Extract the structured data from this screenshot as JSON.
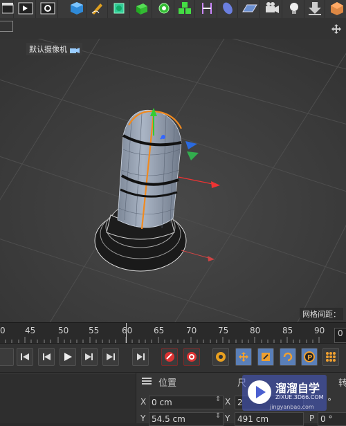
{
  "toolbar": {
    "icons": [
      "clapper-icon",
      "render-view-icon",
      "render-settings-icon",
      "cube-icon",
      "pen-icon",
      "subdivision-icon",
      "extrude-icon",
      "cloner-icon",
      "mograph-icon",
      "deformer-icon",
      "field-icon",
      "floor-icon",
      "camera-icon",
      "light-icon",
      "arrow-down-icon",
      "tag-icon"
    ]
  },
  "viewport": {
    "camera_label": "默认摄像机",
    "grid_label": "网格间距："
  },
  "timeline": {
    "ticks": [
      "0",
      "45",
      "50",
      "55",
      "60",
      "65",
      "70",
      "75",
      "80",
      "85",
      "90"
    ],
    "current_frame": "0"
  },
  "coordinates": {
    "title": "位置",
    "size_title": "尺",
    "rotation_title": "转",
    "x_label": "X",
    "y_label": "Y",
    "pos_x": "0 cm",
    "pos_y": "54.5 cm",
    "size_x_label": "X",
    "size_y_label": "Y",
    "size_x": "2",
    "size_y": "491 cm",
    "rot_x": "°",
    "rot_p_label": "P",
    "rot_p": "0 °"
  },
  "watermark": {
    "brand": "溜溜自学",
    "url": "ZIXUE.3D66.COM",
    "url2": "jingyanbao.com"
  }
}
